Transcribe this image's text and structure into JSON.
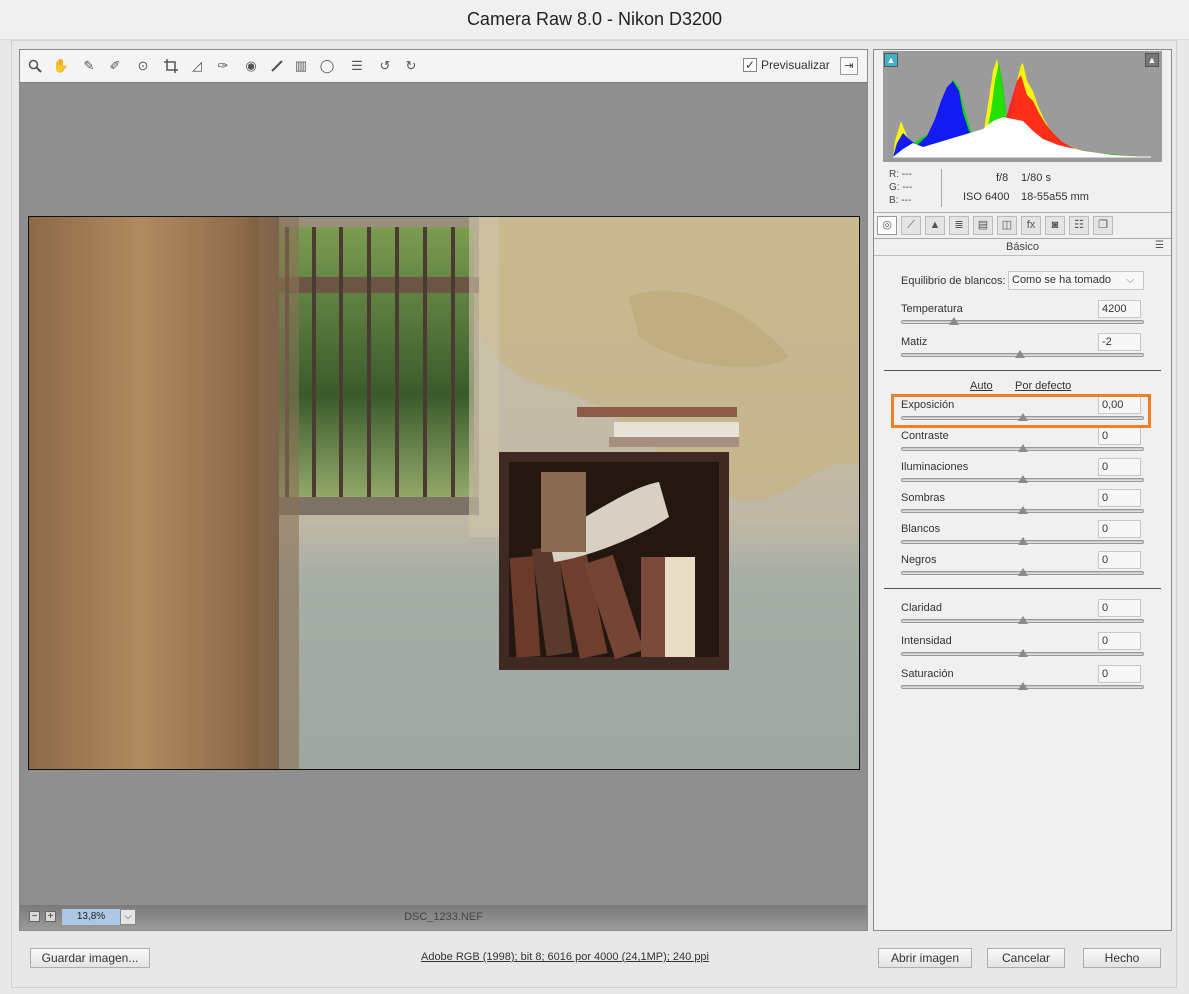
{
  "window": {
    "title": "Camera Raw 8.0 -  Nikon D3200"
  },
  "toolbar": {
    "tools": [
      {
        "name": "zoom-tool-icon",
        "glyph": "⚲"
      },
      {
        "name": "hand-tool-icon",
        "glyph": "✋"
      },
      {
        "name": "white-balance-tool-icon",
        "glyph": "✎"
      },
      {
        "name": "color-sampler-tool-icon",
        "glyph": "✐"
      },
      {
        "name": "targeted-adjustment-tool-icon",
        "glyph": "⊙"
      },
      {
        "name": "crop-tool-icon",
        "glyph": "⌗"
      },
      {
        "name": "straighten-tool-icon",
        "glyph": "◿"
      },
      {
        "name": "spot-removal-tool-icon",
        "glyph": "✑"
      },
      {
        "name": "red-eye-removal-icon",
        "glyph": "◉"
      },
      {
        "name": "adjustment-brush-icon",
        "glyph": "🖌"
      },
      {
        "name": "graduated-filter-icon",
        "glyph": "▥"
      },
      {
        "name": "radial-filter-icon",
        "glyph": "◯"
      },
      {
        "name": "preferences-icon",
        "glyph": "☰"
      },
      {
        "name": "rotate-left-icon",
        "glyph": "↺"
      },
      {
        "name": "rotate-right-icon",
        "glyph": "↻"
      }
    ],
    "preview_label": "Previsualizar",
    "preview_checked": true
  },
  "status": {
    "zoom": "13,8%",
    "filename": "DSC_1233.NEF"
  },
  "histogram": {
    "r": "R:  ---",
    "g": "G:  ---",
    "b": "B:  ---"
  },
  "exif": {
    "aperture": "f/8",
    "shutter": "1/80 s",
    "iso": "ISO 6400",
    "lens": "18-55a55 mm"
  },
  "panel": {
    "title": "Básico",
    "white_balance": {
      "label": "Equilibrio de blancos:",
      "value": "Como se ha tomado"
    },
    "auto": "Auto",
    "default": "Por defecto",
    "sliders": [
      {
        "key": "temperatura",
        "label": "Temperatura",
        "value": "4200",
        "pos": 0.22
      },
      {
        "key": "matiz",
        "label": "Matiz",
        "value": "-2",
        "pos": 0.49
      },
      {
        "key": "exposicion",
        "label": "Exposición",
        "value": "0,00",
        "pos": 0.5
      },
      {
        "key": "contraste",
        "label": "Contraste",
        "value": "0",
        "pos": 0.5
      },
      {
        "key": "iluminaciones",
        "label": "Iluminaciones",
        "value": "0",
        "pos": 0.5
      },
      {
        "key": "sombras",
        "label": "Sombras",
        "value": "0",
        "pos": 0.5
      },
      {
        "key": "blancos",
        "label": "Blancos",
        "value": "0",
        "pos": 0.5
      },
      {
        "key": "negros",
        "label": "Negros",
        "value": "0",
        "pos": 0.5
      },
      {
        "key": "claridad",
        "label": "Claridad",
        "value": "0",
        "pos": 0.5
      },
      {
        "key": "intensidad",
        "label": "Intensidad",
        "value": "0",
        "pos": 0.5
      },
      {
        "key": "saturacion",
        "label": "Saturación",
        "value": "0",
        "pos": 0.5
      }
    ]
  },
  "footer": {
    "save": "Guardar imagen...",
    "image_info": "Adobe RGB (1998); bit 8; 6016 por 4000 (24,1MP); 240 ppi",
    "open": "Abrir imagen",
    "cancel": "Cancelar",
    "done": "Hecho"
  },
  "colors": {
    "highlight": "#f28023",
    "zoom_bg": "#aec7e5"
  }
}
